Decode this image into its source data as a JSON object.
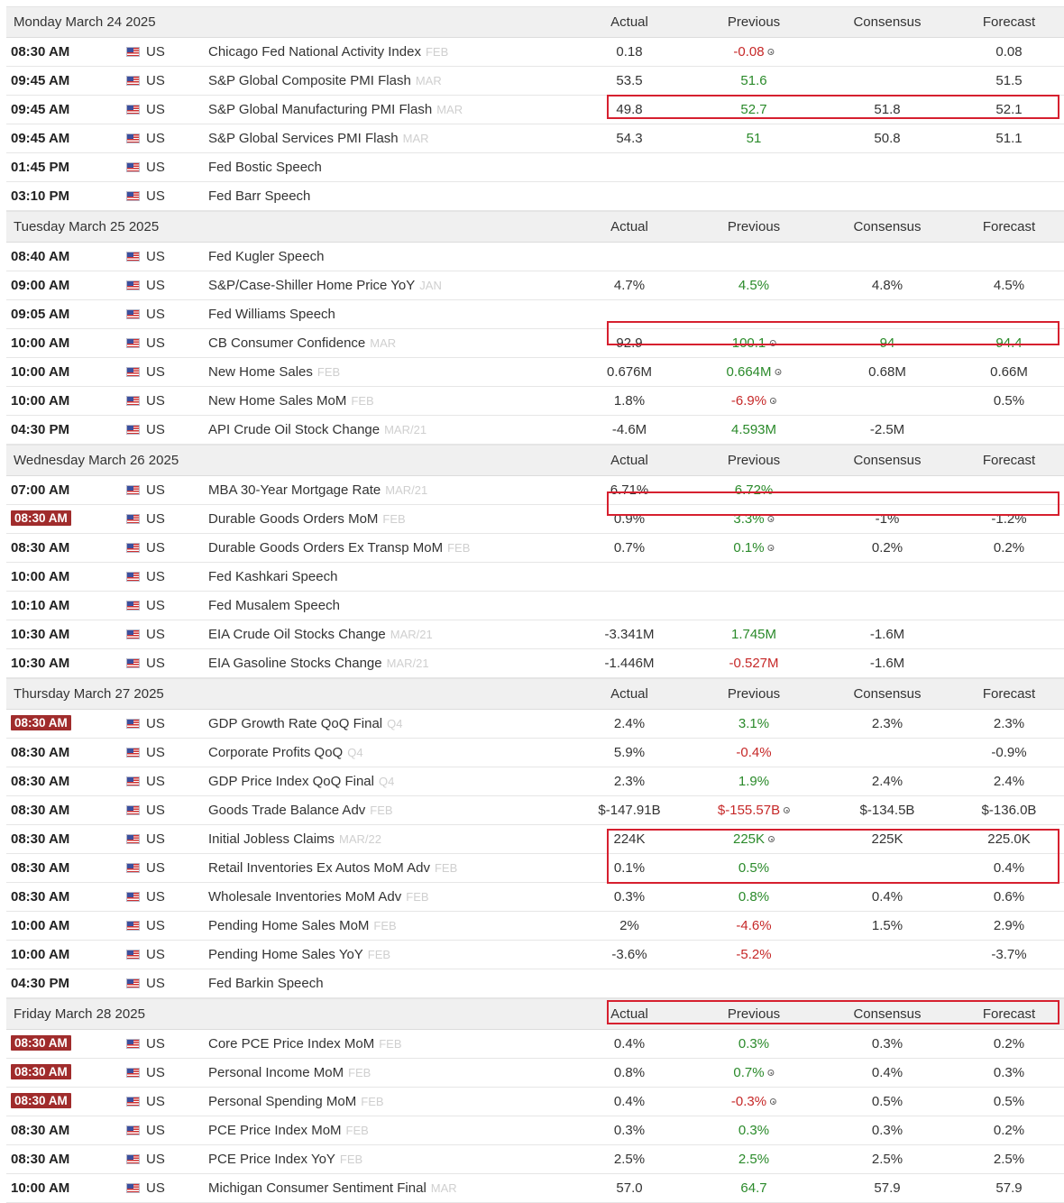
{
  "columns": {
    "actual": "Actual",
    "previous": "Previous",
    "consensus": "Consensus",
    "forecast": "Forecast"
  },
  "days": [
    {
      "label": "Monday March 24 2025",
      "rows": [
        {
          "time": "08:30 AM",
          "country": "US",
          "event": "Chicago Fed National Activity Index",
          "ref": "FEB",
          "actual": "0.18",
          "previous": "-0.08",
          "previous_color": "red",
          "previous_revised": true,
          "consensus": "",
          "forecast": "0.08"
        },
        {
          "time": "09:45 AM",
          "country": "US",
          "event": "S&P Global Composite PMI Flash",
          "ref": "MAR",
          "actual": "53.5",
          "previous": "51.6",
          "previous_color": "green",
          "consensus": "",
          "forecast": "51.5"
        },
        {
          "time": "09:45 AM",
          "country": "US",
          "event": "S&P Global Manufacturing PMI Flash",
          "ref": "MAR",
          "actual": "49.8",
          "previous": "52.7",
          "previous_color": "green",
          "consensus": "51.8",
          "forecast": "52.1",
          "boxed": true
        },
        {
          "time": "09:45 AM",
          "country": "US",
          "event": "S&P Global Services PMI Flash",
          "ref": "MAR",
          "actual": "54.3",
          "previous": "51",
          "previous_color": "green",
          "consensus": "50.8",
          "forecast": "51.1"
        },
        {
          "time": "01:45 PM",
          "country": "US",
          "event": "Fed Bostic Speech",
          "ref": "",
          "actual": "",
          "previous": "",
          "consensus": "",
          "forecast": ""
        },
        {
          "time": "03:10 PM",
          "country": "US",
          "event": "Fed Barr Speech",
          "ref": "",
          "actual": "",
          "previous": "",
          "consensus": "",
          "forecast": ""
        }
      ]
    },
    {
      "label": "Tuesday March 25 2025",
      "rows": [
        {
          "time": "08:40 AM",
          "country": "US",
          "event": "Fed Kugler Speech",
          "ref": "",
          "actual": "",
          "previous": "",
          "consensus": "",
          "forecast": ""
        },
        {
          "time": "09:00 AM",
          "country": "US",
          "event": "S&P/Case-Shiller Home Price YoY",
          "ref": "JAN",
          "actual": "4.7%",
          "previous": "4.5%",
          "previous_color": "green",
          "consensus": "4.8%",
          "forecast": "4.5%"
        },
        {
          "time": "09:05 AM",
          "country": "US",
          "event": "Fed Williams Speech",
          "ref": "",
          "actual": "",
          "previous": "",
          "consensus": "",
          "forecast": ""
        },
        {
          "time": "10:00 AM",
          "country": "US",
          "event": "CB Consumer Confidence",
          "ref": "MAR",
          "actual": "92.9",
          "previous": "100.1",
          "previous_color": "green",
          "previous_revised": true,
          "consensus": "94",
          "consensus_color": "green",
          "forecast": "94.4",
          "forecast_color": "green",
          "boxed": true
        },
        {
          "time": "10:00 AM",
          "country": "US",
          "event": "New Home Sales",
          "ref": "FEB",
          "actual": "0.676M",
          "previous": "0.664M",
          "previous_color": "green",
          "previous_revised": true,
          "consensus": "0.68M",
          "forecast": "0.66M"
        },
        {
          "time": "10:00 AM",
          "country": "US",
          "event": "New Home Sales MoM",
          "ref": "FEB",
          "actual": "1.8%",
          "previous": "-6.9%",
          "previous_color": "red",
          "previous_revised": true,
          "consensus": "",
          "forecast": "0.5%"
        },
        {
          "time": "04:30 PM",
          "country": "US",
          "event": "API Crude Oil Stock Change",
          "ref": "MAR/21",
          "actual": "-4.6M",
          "previous": "4.593M",
          "previous_color": "green",
          "consensus": "-2.5M",
          "forecast": ""
        }
      ]
    },
    {
      "label": "Wednesday March 26 2025",
      "rows": [
        {
          "time": "07:00 AM",
          "country": "US",
          "event": "MBA 30-Year Mortgage Rate",
          "ref": "MAR/21",
          "actual": "6.71%",
          "previous": "6.72%",
          "previous_color": "green",
          "consensus": "",
          "forecast": ""
        },
        {
          "time": "08:30 AM",
          "time_highlight": true,
          "country": "US",
          "event": "Durable Goods Orders MoM",
          "ref": "FEB",
          "actual": "0.9%",
          "previous": "3.3%",
          "previous_color": "green",
          "previous_revised": true,
          "consensus": "-1%",
          "forecast": "-1.2%",
          "boxed": true
        },
        {
          "time": "08:30 AM",
          "country": "US",
          "event": "Durable Goods Orders Ex Transp MoM",
          "ref": "FEB",
          "actual": "0.7%",
          "previous": "0.1%",
          "previous_color": "green",
          "previous_revised": true,
          "consensus": "0.2%",
          "forecast": "0.2%"
        },
        {
          "time": "10:00 AM",
          "country": "US",
          "event": "Fed Kashkari Speech",
          "ref": "",
          "actual": "",
          "previous": "",
          "consensus": "",
          "forecast": ""
        },
        {
          "time": "10:10 AM",
          "country": "US",
          "event": "Fed Musalem Speech",
          "ref": "",
          "actual": "",
          "previous": "",
          "consensus": "",
          "forecast": ""
        },
        {
          "time": "10:30 AM",
          "country": "US",
          "event": "EIA Crude Oil Stocks Change",
          "ref": "MAR/21",
          "actual": "-3.341M",
          "previous": "1.745M",
          "previous_color": "green",
          "consensus": "-1.6M",
          "forecast": ""
        },
        {
          "time": "10:30 AM",
          "country": "US",
          "event": "EIA Gasoline Stocks Change",
          "ref": "MAR/21",
          "actual": "-1.446M",
          "previous": "-0.527M",
          "previous_color": "red",
          "consensus": "-1.6M",
          "forecast": ""
        }
      ]
    },
    {
      "label": "Thursday March 27 2025",
      "rows": [
        {
          "time": "08:30 AM",
          "time_highlight": true,
          "country": "US",
          "event": "GDP Growth Rate QoQ Final",
          "ref": "Q4",
          "actual": "2.4%",
          "previous": "3.1%",
          "previous_color": "green",
          "consensus": "2.3%",
          "forecast": "2.3%"
        },
        {
          "time": "08:30 AM",
          "country": "US",
          "event": "Corporate Profits QoQ",
          "ref": "Q4",
          "actual": "5.9%",
          "previous": "-0.4%",
          "previous_color": "red",
          "consensus": "",
          "forecast": "-0.9%"
        },
        {
          "time": "08:30 AM",
          "country": "US",
          "event": "GDP Price Index QoQ Final",
          "ref": "Q4",
          "actual": "2.3%",
          "previous": "1.9%",
          "previous_color": "green",
          "consensus": "2.4%",
          "forecast": "2.4%"
        },
        {
          "time": "08:30 AM",
          "country": "US",
          "event": "Goods Trade Balance Adv",
          "ref": "FEB",
          "actual": "$-147.91B",
          "previous": "$-155.57B",
          "previous_color": "red",
          "previous_revised": true,
          "consensus": "$-134.5B",
          "forecast": "$-136.0B"
        },
        {
          "time": "08:30 AM",
          "country": "US",
          "event": "Initial Jobless Claims",
          "ref": "MAR/22",
          "actual": "224K",
          "previous": "225K",
          "previous_color": "green",
          "previous_revised": true,
          "consensus": "225K",
          "forecast": "225.0K"
        },
        {
          "time": "08:30 AM",
          "country": "US",
          "event": "Retail Inventories Ex Autos MoM Adv",
          "ref": "FEB",
          "actual": "0.1%",
          "previous": "0.5%",
          "previous_color": "green",
          "consensus": "",
          "forecast": "0.4%",
          "boxed_group_start": true
        },
        {
          "time": "08:30 AM",
          "country": "US",
          "event": "Wholesale Inventories MoM Adv",
          "ref": "FEB",
          "actual": "0.3%",
          "previous": "0.8%",
          "previous_color": "green",
          "consensus": "0.4%",
          "forecast": "0.6%",
          "boxed_group_end": true
        },
        {
          "time": "10:00 AM",
          "country": "US",
          "event": "Pending Home Sales MoM",
          "ref": "FEB",
          "actual": "2%",
          "previous": "-4.6%",
          "previous_color": "red",
          "consensus": "1.5%",
          "forecast": "2.9%"
        },
        {
          "time": "10:00 AM",
          "country": "US",
          "event": "Pending Home Sales YoY",
          "ref": "FEB",
          "actual": "-3.6%",
          "previous": "-5.2%",
          "previous_color": "red",
          "consensus": "",
          "forecast": "-3.7%"
        },
        {
          "time": "04:30 PM",
          "country": "US",
          "event": "Fed Barkin Speech",
          "ref": "",
          "actual": "",
          "previous": "",
          "consensus": "",
          "forecast": ""
        }
      ]
    },
    {
      "label": "Friday March 28 2025",
      "rows": [
        {
          "time": "08:30 AM",
          "time_highlight": true,
          "country": "US",
          "event": "Core PCE Price Index MoM",
          "ref": "FEB",
          "actual": "0.4%",
          "previous": "0.3%",
          "previous_color": "green",
          "consensus": "0.3%",
          "forecast": "0.2%",
          "boxed": true
        },
        {
          "time": "08:30 AM",
          "time_highlight": true,
          "country": "US",
          "event": "Personal Income MoM",
          "ref": "FEB",
          "actual": "0.8%",
          "previous": "0.7%",
          "previous_color": "green",
          "previous_revised": true,
          "consensus": "0.4%",
          "forecast": "0.3%"
        },
        {
          "time": "08:30 AM",
          "time_highlight": true,
          "country": "US",
          "event": "Personal Spending MoM",
          "ref": "FEB",
          "actual": "0.4%",
          "previous": "-0.3%",
          "previous_color": "red",
          "previous_revised": true,
          "consensus": "0.5%",
          "forecast": "0.5%"
        },
        {
          "time": "08:30 AM",
          "country": "US",
          "event": "PCE Price Index MoM",
          "ref": "FEB",
          "actual": "0.3%",
          "previous": "0.3%",
          "previous_color": "green",
          "consensus": "0.3%",
          "forecast": "0.2%"
        },
        {
          "time": "08:30 AM",
          "country": "US",
          "event": "PCE Price Index YoY",
          "ref": "FEB",
          "actual": "2.5%",
          "previous": "2.5%",
          "previous_color": "green",
          "consensus": "2.5%",
          "forecast": "2.5%"
        },
        {
          "time": "10:00 AM",
          "country": "US",
          "event": "Michigan Consumer Sentiment Final",
          "ref": "MAR",
          "actual": "57.0",
          "previous": "64.7",
          "previous_color": "green",
          "consensus": "57.9",
          "forecast": "57.9"
        }
      ]
    }
  ]
}
